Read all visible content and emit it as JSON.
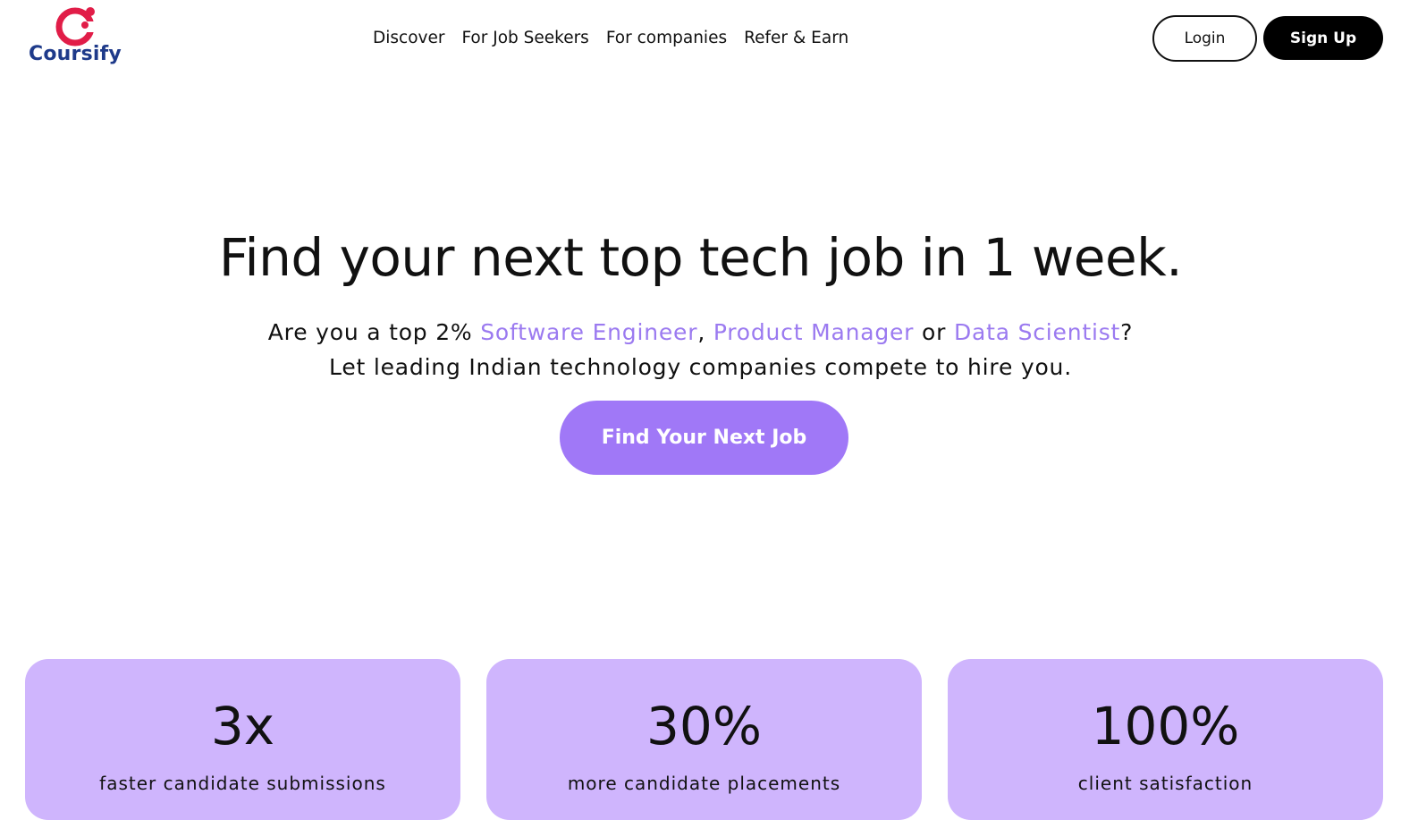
{
  "brand": {
    "name": "Coursify",
    "logo_icon": "coursify-c-logo",
    "name_color": "#1e3a8a",
    "mark_color": "#e11d48"
  },
  "nav": {
    "items": [
      {
        "label": "Discover"
      },
      {
        "label": "For Job Seekers"
      },
      {
        "label": "For companies"
      },
      {
        "label": "Refer & Earn"
      }
    ]
  },
  "auth": {
    "login_label": "Login",
    "signup_label": "Sign Up"
  },
  "hero": {
    "title": "Find your next top tech job in 1 week.",
    "line1_prefix": "Are you a top 2% ",
    "roles": [
      "Software Engineer",
      "Product Manager",
      "Data Scientist"
    ],
    "sep_comma": ", ",
    "sep_or": " or ",
    "line1_suffix": "?",
    "line2": "Let leading Indian technology companies compete to hire you.",
    "cta_label": "Find Your Next Job",
    "accent_color": "#a078f7"
  },
  "stats": [
    {
      "value": "3x",
      "label": "faster candidate submissions"
    },
    {
      "value": "30%",
      "label": "more candidate placements"
    },
    {
      "value": "100%",
      "label": "client satisfaction"
    }
  ],
  "colors": {
    "card_bg": "#cfb5fd",
    "link_purple": "#9b7af0"
  }
}
